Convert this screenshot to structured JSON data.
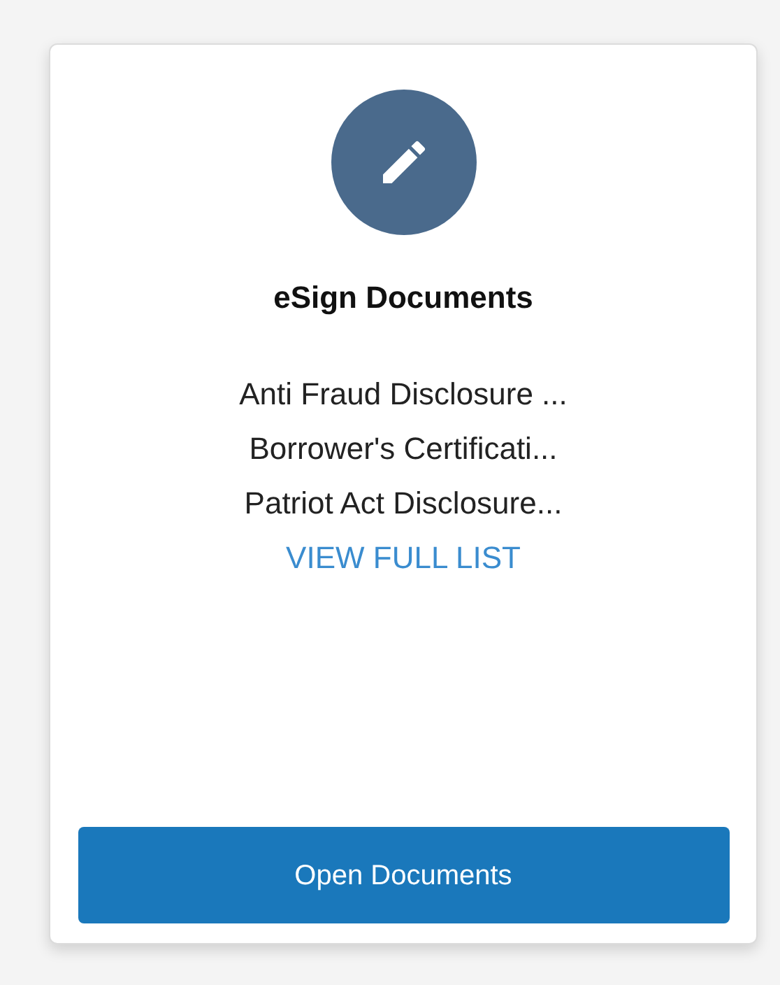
{
  "card": {
    "title": "eSign Documents",
    "documents": [
      "Anti Fraud Disclosure ...",
      "Borrower's Certificati...",
      "Patriot Act Disclosure..."
    ],
    "link": "VIEW FULL LIST",
    "button": "Open Documents"
  }
}
